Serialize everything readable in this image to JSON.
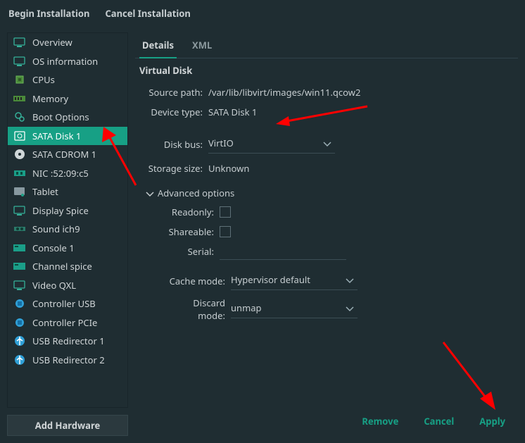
{
  "topbar": {
    "begin": "Begin Installation",
    "cancel": "Cancel Installation"
  },
  "sidebar": {
    "items": [
      {
        "label": "Overview",
        "icon": "monitor",
        "selected": false
      },
      {
        "label": "OS information",
        "icon": "monitor",
        "selected": false
      },
      {
        "label": "CPUs",
        "icon": "cpu",
        "selected": false
      },
      {
        "label": "Memory",
        "icon": "memory",
        "selected": false
      },
      {
        "label": "Boot Options",
        "icon": "gears",
        "selected": false
      },
      {
        "label": "SATA Disk 1",
        "icon": "disk",
        "selected": true
      },
      {
        "label": "SATA CDROM 1",
        "icon": "cdrom",
        "selected": false
      },
      {
        "label": "NIC :52:09:c5",
        "icon": "nic",
        "selected": false
      },
      {
        "label": "Tablet",
        "icon": "tablet",
        "selected": false
      },
      {
        "label": "Display Spice",
        "icon": "monitor",
        "selected": false
      },
      {
        "label": "Sound ich9",
        "icon": "sound",
        "selected": false
      },
      {
        "label": "Console 1",
        "icon": "console",
        "selected": false
      },
      {
        "label": "Channel spice",
        "icon": "console",
        "selected": false
      },
      {
        "label": "Video QXL",
        "icon": "monitor",
        "selected": false
      },
      {
        "label": "Controller USB",
        "icon": "controller",
        "selected": false
      },
      {
        "label": "Controller PCIe",
        "icon": "controller",
        "selected": false
      },
      {
        "label": "USB Redirector 1",
        "icon": "usb",
        "selected": false
      },
      {
        "label": "USB Redirector 2",
        "icon": "usb",
        "selected": false
      }
    ],
    "add_hw": "Add Hardware"
  },
  "tabs": [
    {
      "label": "Details",
      "active": true
    },
    {
      "label": "XML",
      "active": false
    }
  ],
  "panel": {
    "title": "Virtual Disk",
    "source_path_lab": "Source path:",
    "source_path_val": "/var/lib/libvirt/images/win11.qcow2",
    "device_type_lab": "Device type:",
    "device_type_val": "SATA Disk 1",
    "disk_bus_lab": "Disk bus:",
    "disk_bus_val": "VirtIO",
    "storage_size_lab": "Storage size:",
    "storage_size_val": "Unknown",
    "advanced_lab": "Advanced options",
    "readonly_lab": "Readonly:",
    "shareable_lab": "Shareable:",
    "serial_lab": "Serial:",
    "serial_val": "",
    "cache_mode_lab": "Cache mode:",
    "cache_mode_val": "Hypervisor default",
    "discard_mode_lab": "Discard mode:",
    "discard_mode_val": "unmap"
  },
  "footer": {
    "remove": "Remove",
    "cancel": "Cancel",
    "apply": "Apply"
  }
}
